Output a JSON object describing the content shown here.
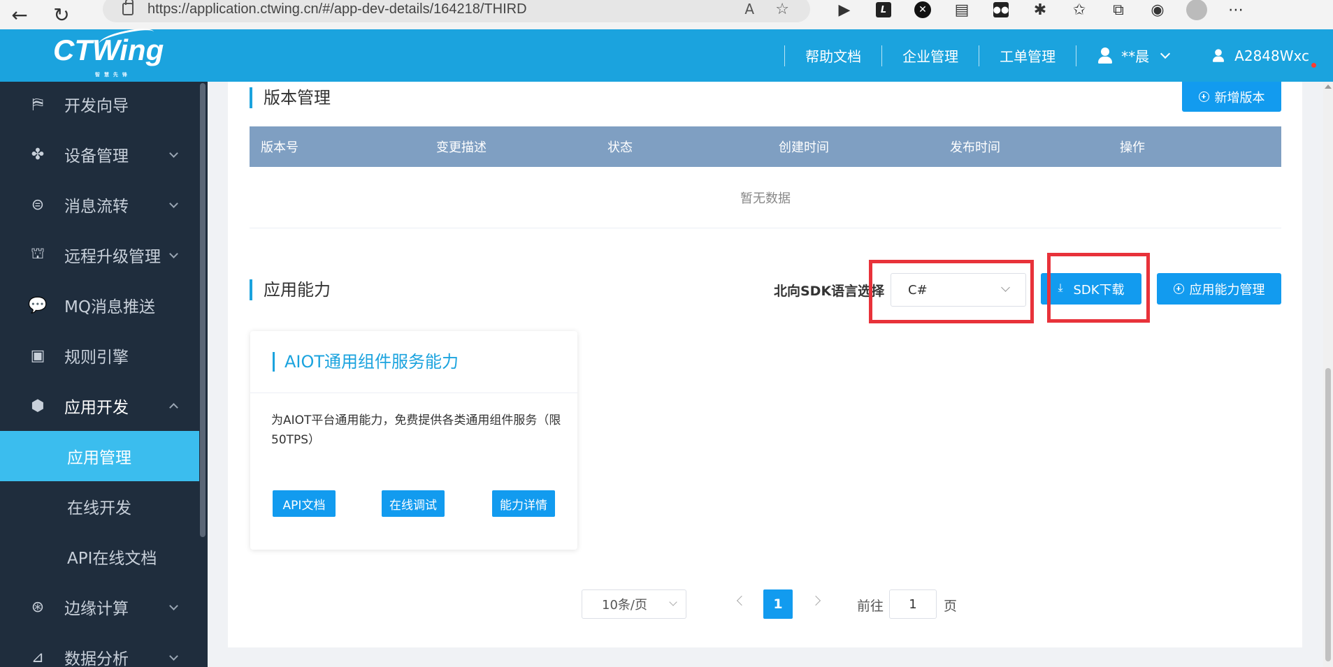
{
  "browser": {
    "url": "https://application.ctwing.cn/#/app-dev-details/164218/THIRD",
    "read_aloud": "A",
    "ext_box_label": "L",
    "ext_x_label": "✕"
  },
  "header": {
    "logo_text": "CTWing",
    "logo_sub": "智 慧 先 锋",
    "nav": [
      "帮助文档",
      "企业管理",
      "工单管理"
    ],
    "user_name": "**晨",
    "account": "A2848Wxc",
    "colors": {
      "brand": "#1ba3de"
    }
  },
  "sidebar": {
    "items": [
      {
        "label": "开发向导",
        "icon": "signpost-icon",
        "arrow": "none"
      },
      {
        "label": "设备管理",
        "icon": "grid-icon",
        "arrow": "down"
      },
      {
        "label": "消息流转",
        "icon": "stream-icon",
        "arrow": "down"
      },
      {
        "label": "远程升级管理",
        "icon": "rocket-icon",
        "arrow": "down"
      },
      {
        "label": "MQ消息推送",
        "icon": "chat-icon",
        "arrow": "none"
      },
      {
        "label": "规则引擎",
        "icon": "clipboard-icon",
        "arrow": "none"
      },
      {
        "label": "应用开发",
        "icon": "cube-icon",
        "arrow": "up"
      }
    ],
    "sub_items": [
      "应用管理",
      "在线开发",
      "API在线文档"
    ],
    "active_sub": "应用管理",
    "more_items": [
      {
        "label": "边缘计算",
        "icon": "edge-icon",
        "arrow": "down"
      },
      {
        "label": "数据分析",
        "icon": "chart-icon",
        "arrow": "down"
      }
    ]
  },
  "version": {
    "title": "版本管理",
    "add_button": "新增版本",
    "columns": [
      "版本号",
      "变更描述",
      "状态",
      "创建时间",
      "发布时间",
      "操作"
    ],
    "empty_text": "暂无数据"
  },
  "ability": {
    "title": "应用能力",
    "sdk_label": "北向SDK语言选择",
    "sdk_value": "C#",
    "sdk_download": "SDK下载",
    "manage_button": "应用能力管理",
    "card": {
      "title": "AIOT通用组件服务能力",
      "desc": "为AIOT平台通用能力，免费提供各类通用组件服务（限50TPS）",
      "buttons": [
        "API文档",
        "在线调试",
        "能力详情"
      ]
    }
  },
  "pagination": {
    "page_size": "10条/页",
    "current": "1",
    "goto_label": "前往",
    "goto_value": "1",
    "page_suffix": "页"
  }
}
